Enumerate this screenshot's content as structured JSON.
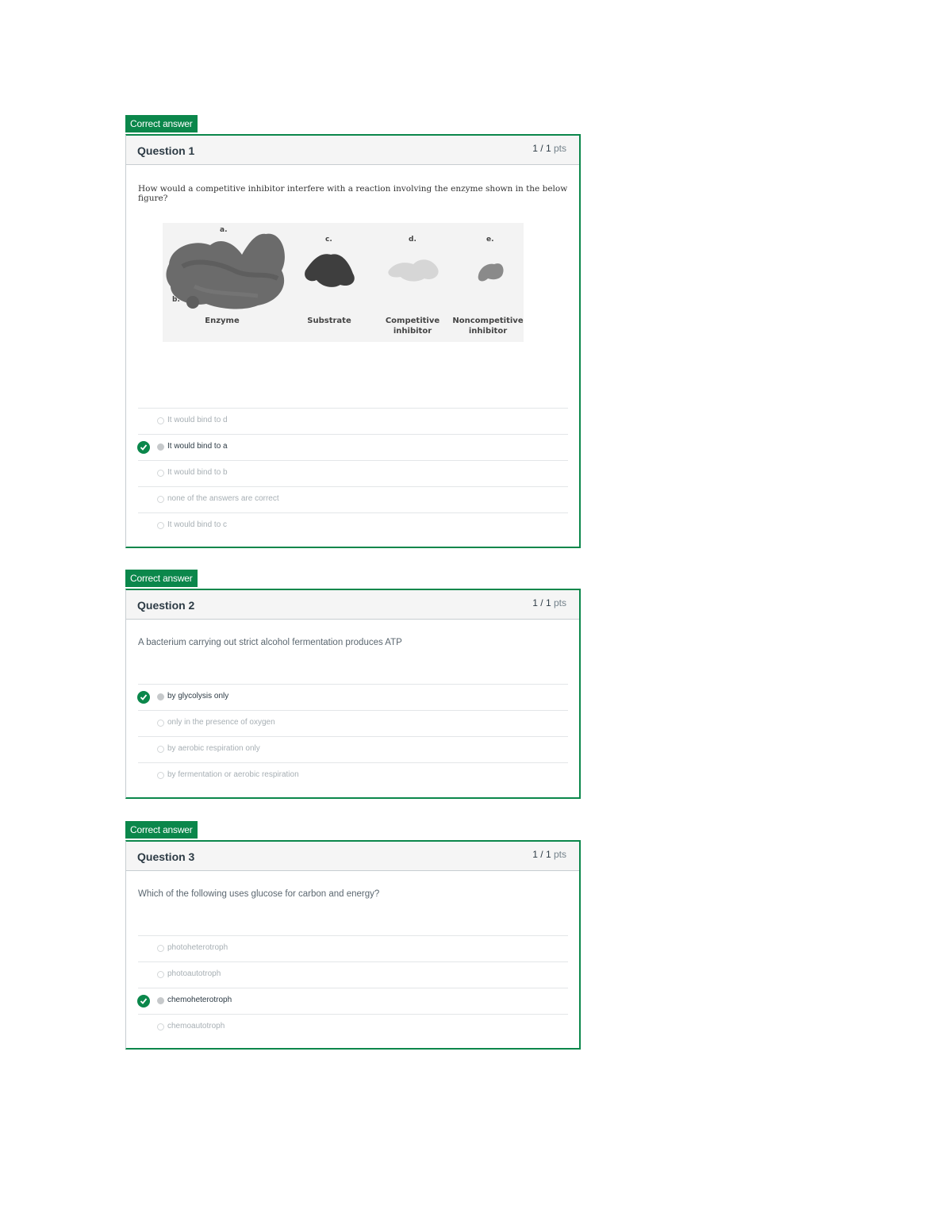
{
  "questions": [
    {
      "badge": "Correct answer",
      "title": "Question 1",
      "score": "1 / 1",
      "score_unit": "pts",
      "text": "How would a competitive inhibitor interfere with a reaction involving the enzyme shown in the below figure?",
      "figure": {
        "letters": [
          "a.",
          "b.",
          "c.",
          "d.",
          "e."
        ],
        "labels": [
          "Enzyme",
          "Substrate",
          "Competitive inhibitor",
          "Noncompetitive inhibitor"
        ]
      },
      "answers": [
        {
          "label": "It would bind to d",
          "selected": false
        },
        {
          "label": "It would bind to a",
          "selected": true
        },
        {
          "label": "It would bind to b",
          "selected": false
        },
        {
          "label": "none of the answers are correct",
          "selected": false
        },
        {
          "label": "It would bind to c",
          "selected": false
        }
      ]
    },
    {
      "badge": "Correct answer",
      "title": "Question 2",
      "score": "1 / 1",
      "score_unit": "pts",
      "text": "A bacterium carrying out strict alcohol fermentation produces ATP",
      "answers": [
        {
          "label": "by glycolysis only",
          "selected": true
        },
        {
          "label": "only in the presence of oxygen",
          "selected": false
        },
        {
          "label": "by aerobic respiration only",
          "selected": false
        },
        {
          "label": "by fermentation or aerobic respiration",
          "selected": false
        }
      ]
    },
    {
      "badge": "Correct answer",
      "title": "Question 3",
      "score": "1 / 1",
      "score_unit": "pts",
      "text": "Which of the following uses glucose for carbon and energy?",
      "answers": [
        {
          "label": "photoheterotroph",
          "selected": false
        },
        {
          "label": "photoautotroph",
          "selected": false
        },
        {
          "label": "chemoheterotroph",
          "selected": true
        },
        {
          "label": "chemoautotroph",
          "selected": false
        }
      ]
    }
  ],
  "colors": {
    "accent_green": "#0b874b",
    "text": "#2d3b45",
    "muted": "#a7afb4"
  },
  "icons": {
    "correct": "check-circle-icon",
    "radio": "radio-icon"
  }
}
